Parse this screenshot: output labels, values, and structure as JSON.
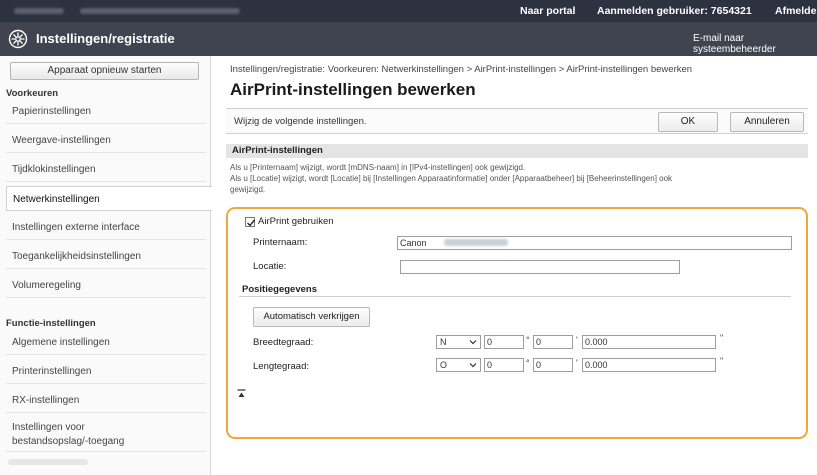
{
  "topbar": {
    "portal": "Naar portal",
    "user_label": "Aanmelden gebruiker:",
    "user_id": "7654321",
    "logout": "Afmelden"
  },
  "header": {
    "icon": "gear-icon",
    "title": "Instellingen/registratie",
    "email_link": "E-mail naar systeembeheerder"
  },
  "sidebar": {
    "restart": "Apparaat opnieuw starten",
    "section_preferences": "Voorkeuren",
    "pref_items": [
      "Papierinstellingen",
      "Weergave-instellingen",
      "Tijdklokinstellingen",
      "Netwerkinstellingen",
      "Instellingen externe interface",
      "Toegankelijkheidsinstellingen",
      "Volumeregeling"
    ],
    "active_item": "Netwerkinstellingen",
    "section_functions": "Functie-instellingen",
    "func_items": [
      "Algemene instellingen",
      "Printerinstellingen",
      "RX-instellingen"
    ],
    "func_item_multi_line1": "Instellingen voor",
    "func_item_multi_line2": "bestandsopslag/-toegang"
  },
  "main": {
    "breadcrumb": "Instellingen/registratie: Voorkeuren: Netwerkinstellingen > AirPrint-instellingen > AirPrint-instellingen bewerken",
    "title": "AirPrint-instellingen bewerken",
    "instruction": "Wijzig de volgende instellingen.",
    "ok": "OK",
    "cancel": "Annuleren",
    "section_title": "AirPrint-instellingen",
    "note_line1": "Als u [Printernaam] wijzigt, wordt [mDNS-naam] in [IPv4-instellingen] ook gewijzigd.",
    "note_line2": "Als u [Locatie] wijzigt, wordt [Locatie] bij [Instellingen Apparaatinformatie] onder [Apparaatbeheer] bij [Beheerinstellingen] ook",
    "note_line3": "gewijzigd.",
    "use_airprint_label": "AirPrint gebruiken",
    "use_airprint_checked": true,
    "printer_name_label": "Printernaam:",
    "printer_name_value": "Canon",
    "location_label": "Locatie:",
    "location_value": "",
    "position_section": "Positiegegevens",
    "auto_obtain": "Automatisch verkrijgen",
    "latitude_label": "Breedtegraad:",
    "latitude_dir": "N",
    "latitude_deg": "0",
    "latitude_min": "0",
    "latitude_sec": "0.000",
    "longitude_label": "Lengtegraad:",
    "longitude_dir": "O",
    "longitude_deg": "0",
    "longitude_min": "0",
    "longitude_sec": "0.000",
    "unit_deg": "°",
    "unit_min": "'",
    "unit_sec": "\""
  },
  "colors": {
    "topbar": "#2d3240",
    "titlebar": "#40444f",
    "highlight_frame": "#f0a63c"
  }
}
